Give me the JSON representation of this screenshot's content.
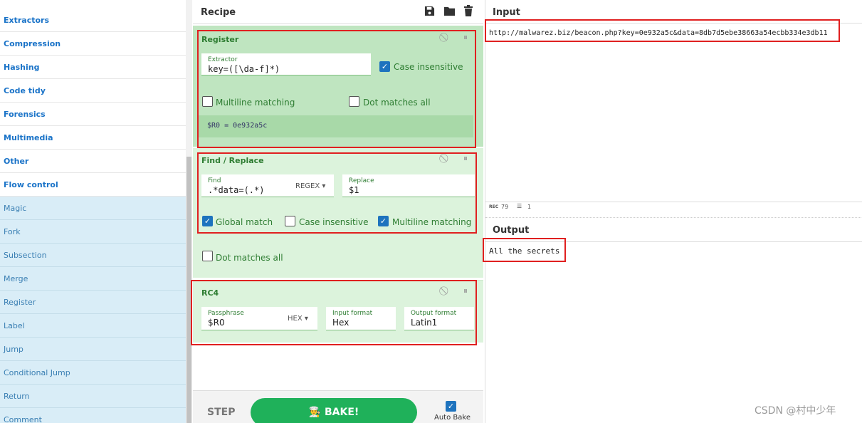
{
  "sidebar": {
    "categories": [
      "Extractors",
      "Compression",
      "Hashing",
      "Code tidy",
      "Forensics",
      "Multimedia",
      "Other",
      "Flow control"
    ],
    "operations": [
      "Magic",
      "Fork",
      "Subsection",
      "Merge",
      "Register",
      "Label",
      "Jump",
      "Conditional Jump",
      "Return",
      "Comment"
    ]
  },
  "recipe": {
    "title": "Recipe",
    "icons": {
      "save": "save-icon",
      "load": "folder-icon",
      "clear": "trash-icon"
    },
    "register": {
      "title": "Register",
      "extractor_label": "Extractor",
      "extractor_value": "key=([\\da-f]*)",
      "case_insensitive": "Case insensitive",
      "multiline": "Multiline matching",
      "dot_matches_all": "Dot matches all",
      "result": "$R0 = 0e932a5c"
    },
    "find_replace": {
      "title": "Find / Replace",
      "find_label": "Find",
      "find_value": ".*data=(.*)",
      "find_mode": "REGEX",
      "replace_label": "Replace",
      "replace_value": "$1",
      "global_match": "Global match",
      "case_insensitive": "Case insensitive",
      "multiline": "Multiline matching",
      "dot_matches_all": "Dot matches all"
    },
    "rc4": {
      "title": "RC4",
      "passphrase_label": "Passphrase",
      "passphrase_value": "$R0",
      "passphrase_mode": "HEX",
      "input_format_label": "Input format",
      "input_format_value": "Hex",
      "output_format_label": "Output format",
      "output_format_value": "Latin1"
    },
    "step_label": "STEP",
    "bake_label": "BAKE!",
    "auto_bake_label": "Auto Bake"
  },
  "input": {
    "title": "Input",
    "text": "http://malwarez.biz/beacon.php?key=0e932a5c&data=8db7d5ebe38663a54ecbb334e3db11",
    "length_badge": "REC",
    "length": "79",
    "lines": "1"
  },
  "output": {
    "title": "Output",
    "text": "All the secrets"
  },
  "watermark": "CSDN @村中少年",
  "colors": {
    "accent_green": "#1fb15a",
    "op_bg": "#dcf3dc",
    "highlight": "#e02020"
  }
}
